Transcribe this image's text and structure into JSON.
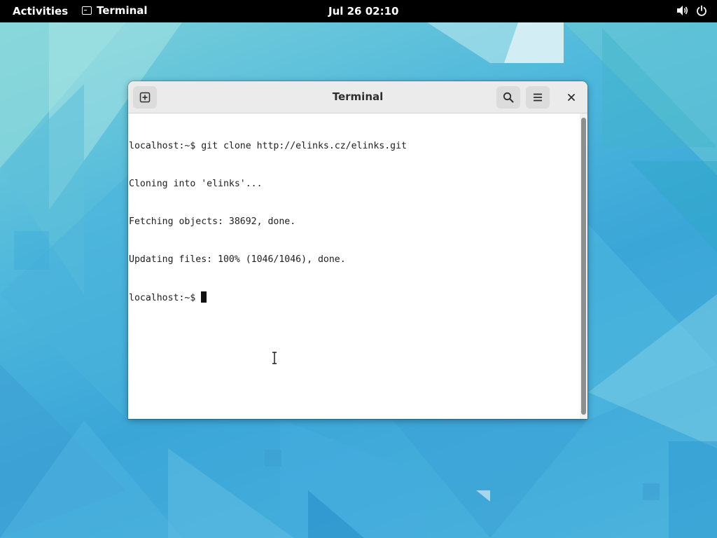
{
  "topbar": {
    "activities": "Activities",
    "app_name": "Terminal",
    "clock": "Jul 26  02:10",
    "icons": [
      "terminal-app-icon",
      "volume-icon",
      "power-icon"
    ]
  },
  "window": {
    "title": "Terminal",
    "icons": [
      "new-tab-icon",
      "search-icon",
      "hamburger-menu-icon",
      "close-icon"
    ]
  },
  "terminal": {
    "lines": [
      "localhost:~$ git clone http://elinks.cz/elinks.git",
      "Cloning into 'elinks'...",
      "Fetching objects: 38692, done.",
      "Updating files: 100% (1046/1046), done."
    ],
    "prompt": "localhost:~$ "
  },
  "colors": {
    "topbar": "#000000",
    "headerbar": "#ebebeb",
    "terminal_bg": "#ffffff",
    "terminal_fg": "#1e1e1e",
    "wallpaper_accent": "#3aa6d8"
  }
}
